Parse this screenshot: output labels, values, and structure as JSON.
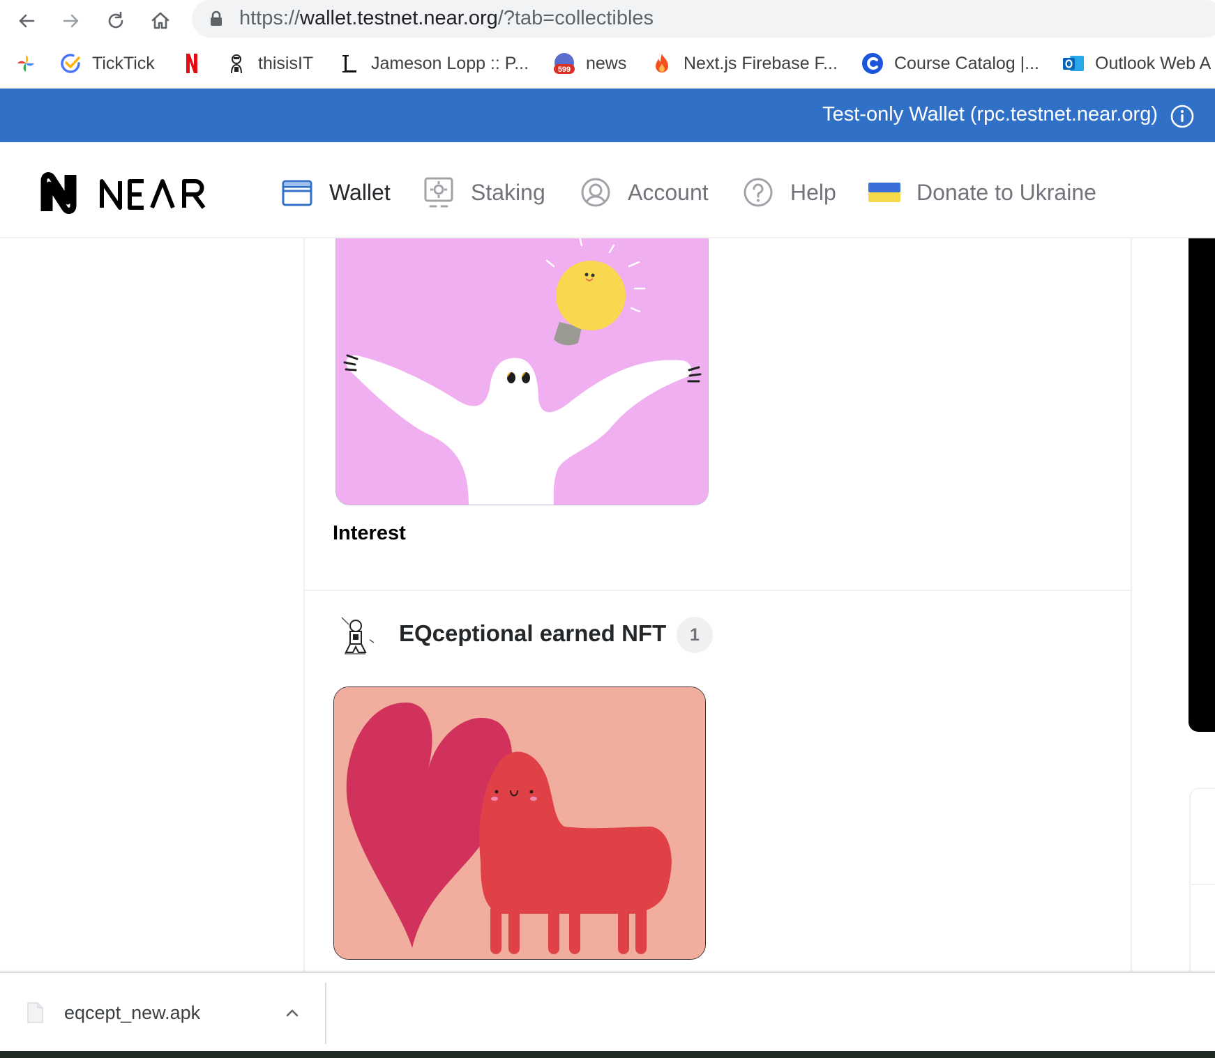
{
  "browser": {
    "url_scheme": "https://",
    "url_host": "wallet.testnet.near.org",
    "url_path": "/?tab=collectibles",
    "bookmarks": [
      {
        "label": "",
        "icon": "photos-pinwheel-icon"
      },
      {
        "label": "TickTick",
        "icon": "ticktick-check-icon"
      },
      {
        "label": "",
        "icon": "netflix-n-icon"
      },
      {
        "label": "thisisIT",
        "icon": "avatar-sketch-icon"
      },
      {
        "label": "Jameson Lopp :: P...",
        "icon": "lopp-l-icon"
      },
      {
        "label": "news",
        "icon": "news-badge-icon",
        "badge": "599"
      },
      {
        "label": "Next.js Firebase F...",
        "icon": "fire-icon"
      },
      {
        "label": "Course Catalog |...",
        "icon": "course-c-icon"
      },
      {
        "label": "Outlook Web A",
        "icon": "outlook-icon"
      }
    ]
  },
  "banner": {
    "text": "Test-only Wallet  (rpc.testnet.near.org)",
    "color": "#3170c7"
  },
  "nav": {
    "items": [
      {
        "label": "Wallet",
        "icon": "wallet-icon",
        "active": true
      },
      {
        "label": "Staking",
        "icon": "staking-icon",
        "active": false
      },
      {
        "label": "Account",
        "icon": "account-icon",
        "active": false
      },
      {
        "label": "Help",
        "icon": "help-icon",
        "active": false
      },
      {
        "label": "Donate to Ukraine",
        "icon": "ukraine-flag-icon",
        "active": false
      }
    ]
  },
  "collectibles": {
    "first_nft_title": "Interest",
    "collection_name": "EQceptional earned NFT",
    "collection_count": "1"
  },
  "downloads": {
    "file_name": "eqcept_new.apk"
  }
}
